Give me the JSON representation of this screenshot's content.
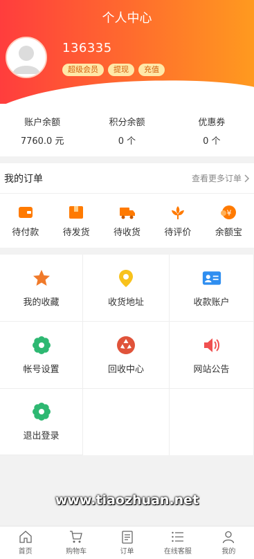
{
  "header": {
    "title": "个人中心",
    "username": "136335",
    "tags": [
      "超级会员",
      "提现",
      "充值"
    ]
  },
  "balances": [
    {
      "label": "账户余额",
      "value": "7760.0 元"
    },
    {
      "label": "积分余额",
      "value": "0 个"
    },
    {
      "label": "优惠券",
      "value": "0 个"
    }
  ],
  "orders": {
    "title": "我的订单",
    "more": "查看更多订单",
    "items": [
      {
        "label": "待付款",
        "icon": "wallet-icon"
      },
      {
        "label": "待发货",
        "icon": "package-icon"
      },
      {
        "label": "待收货",
        "icon": "truck-icon"
      },
      {
        "label": "待评价",
        "icon": "flower-icon"
      },
      {
        "label": "余额宝",
        "icon": "coin-icon"
      }
    ]
  },
  "menu": [
    {
      "label": "我的收藏",
      "icon": "star-icon"
    },
    {
      "label": "收货地址",
      "icon": "location-pin-icon"
    },
    {
      "label": "收款账户",
      "icon": "id-card-icon"
    },
    {
      "label": "帐号设置",
      "icon": "gear-flower-icon"
    },
    {
      "label": "回收中心",
      "icon": "recycle-icon"
    },
    {
      "label": "网站公告",
      "icon": "speaker-icon"
    },
    {
      "label": "退出登录",
      "icon": "logout-flower-icon"
    }
  ],
  "watermark": "www.tiaozhuan.net",
  "tabbar": [
    {
      "label": "首页",
      "icon": "home-icon"
    },
    {
      "label": "购物车",
      "icon": "cart-icon"
    },
    {
      "label": "订单",
      "icon": "clipboard-icon"
    },
    {
      "label": "在线客服",
      "icon": "list-icon"
    },
    {
      "label": "我的",
      "icon": "user-icon"
    }
  ],
  "colors": {
    "header_start": "#ff3d3d",
    "header_end": "#ff9a1f",
    "order_icon": "#ff7a00",
    "star": "#f07a2a",
    "pin": "#f8c21c",
    "card": "#2f8ef0",
    "green": "#2eb872",
    "recycle": "#e0533a",
    "speaker": "#f05050"
  }
}
